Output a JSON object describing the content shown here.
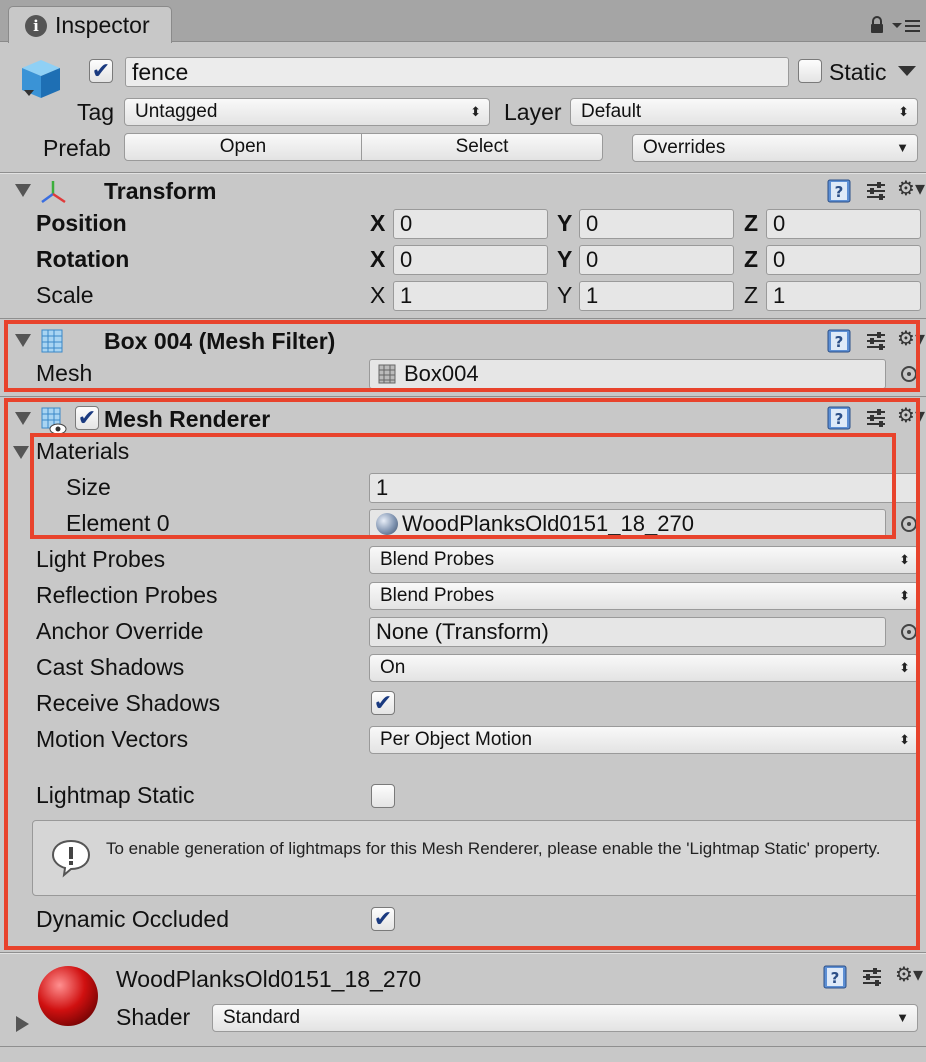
{
  "window": {
    "tab_title": "Inspector"
  },
  "object": {
    "name": "fence",
    "active": true,
    "static_label": "Static",
    "static_checked": false
  },
  "tag": {
    "label": "Tag",
    "value": "Untagged"
  },
  "layer": {
    "label": "Layer",
    "value": "Default"
  },
  "prefab": {
    "label": "Prefab",
    "open": "Open",
    "select": "Select",
    "overrides": "Overrides"
  },
  "transform": {
    "title": "Transform",
    "rows": [
      {
        "label": "Position",
        "x": "0",
        "y": "0",
        "z": "0"
      },
      {
        "label": "Rotation",
        "x": "0",
        "y": "0",
        "z": "0"
      },
      {
        "label": "Scale",
        "x": "1",
        "y": "1",
        "z": "1"
      }
    ],
    "axis": {
      "x": "X",
      "y": "Y",
      "z": "Z"
    }
  },
  "mesh_filter": {
    "title": "Box 004 (Mesh Filter)",
    "mesh_label": "Mesh",
    "mesh_value": "Box004"
  },
  "mesh_renderer": {
    "title": "Mesh Renderer",
    "enabled": true,
    "materials_label": "Materials",
    "size_label": "Size",
    "size_value": "1",
    "element0_label": "Element 0",
    "element0_value": "WoodPlanksOld0151_18_270",
    "light_probes_label": "Light Probes",
    "light_probes_value": "Blend Probes",
    "reflection_probes_label": "Reflection Probes",
    "reflection_probes_value": "Blend Probes",
    "anchor_override_label": "Anchor Override",
    "anchor_override_value": "None (Transform)",
    "cast_shadows_label": "Cast Shadows",
    "cast_shadows_value": "On",
    "receive_shadows_label": "Receive Shadows",
    "receive_shadows_checked": true,
    "motion_vectors_label": "Motion Vectors",
    "motion_vectors_value": "Per Object Motion",
    "lightmap_static_label": "Lightmap Static",
    "lightmap_static_checked": false,
    "help_text": "To enable generation of lightmaps for this Mesh Renderer, please enable the 'Lightmap Static' property.",
    "dynamic_occluded_label": "Dynamic Occluded",
    "dynamic_occluded_checked": true
  },
  "material": {
    "name": "WoodPlanksOld0151_18_270",
    "shader_label": "Shader",
    "shader_value": "Standard"
  },
  "colors": {
    "highlight": "#e8432c",
    "panel": "#c8c8c8",
    "field": "#e6e6e6"
  }
}
